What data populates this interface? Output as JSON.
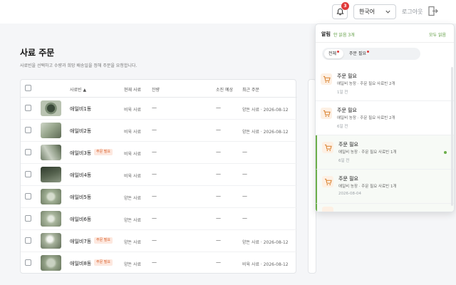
{
  "header": {
    "notification_count": "3",
    "language": "한국어",
    "logout_label": "로그아웃"
  },
  "page": {
    "title": "사료 주문",
    "subtitle": "사료빈을 선택하고 수량과 희망 배송일을 정해 주문을 요청합니다."
  },
  "table": {
    "columns": {
      "bin": "사료빈 ▲",
      "current_feed": "현재 사료",
      "remaining": "잔량",
      "depletion": "소진 예상",
      "recent_order": "최근 주문"
    },
    "rows": [
      {
        "name": "애일비1동",
        "tag": "",
        "feed": "비육 사료",
        "remaining": "—",
        "depletion": "—",
        "recent": "양돈 사료 · 2026-08-12"
      },
      {
        "name": "애일비2동",
        "tag": "",
        "feed": "비육 사료",
        "remaining": "—",
        "depletion": "—",
        "recent": "양돈 사료 · 2026-08-12"
      },
      {
        "name": "애일비3동",
        "tag": "주문 필요",
        "feed": "비육 사료",
        "remaining": "—",
        "depletion": "—",
        "recent": "—"
      },
      {
        "name": "애일비4동",
        "tag": "",
        "feed": "비육 사료",
        "remaining": "—",
        "depletion": "—",
        "recent": "—"
      },
      {
        "name": "애일비5동",
        "tag": "",
        "feed": "양돈 사료",
        "remaining": "—",
        "depletion": "—",
        "recent": "—"
      },
      {
        "name": "애일비6동",
        "tag": "",
        "feed": "양돈 사료",
        "remaining": "—",
        "depletion": "—",
        "recent": "—"
      },
      {
        "name": "애일비7동",
        "tag": "주문 필요",
        "feed": "양돈 사료",
        "remaining": "—",
        "depletion": "—",
        "recent": "양돈 사료 · 2026-08-12"
      },
      {
        "name": "애일비8동",
        "tag": "주문 필요",
        "feed": "양돈 사료",
        "remaining": "—",
        "depletion": "—",
        "recent": "비육 사료 · 2026-08-12"
      }
    ]
  },
  "notifications": {
    "title": "알림",
    "unread_text": "안 읽음 3개",
    "read_all": "모두 읽음",
    "tabs": [
      {
        "label": "전체"
      },
      {
        "label": "주문 필요"
      }
    ],
    "items": [
      {
        "title": "주문 필요",
        "desc": "애일비 농장 · 주문 필요 사료빈 2개",
        "time": "1일 전",
        "unread": false
      },
      {
        "title": "주문 필요",
        "desc": "애일비 농장 · 주문 필요 사료빈 2개",
        "time": "6일 전",
        "unread": false
      },
      {
        "title": "주문 필요",
        "desc": "애일비 농장 · 주문 필요 사료빈 1개",
        "time": "6일 전",
        "unread": true
      },
      {
        "title": "주문 필요",
        "desc": "애일비 농장 · 주문 필요 사료빈 1개",
        "time": "2026-08-04",
        "unread": true
      }
    ]
  },
  "colors": {
    "accent_green": "#5a9a3c",
    "tag_orange": "#d9602b",
    "badge_red": "#e03a3a"
  }
}
